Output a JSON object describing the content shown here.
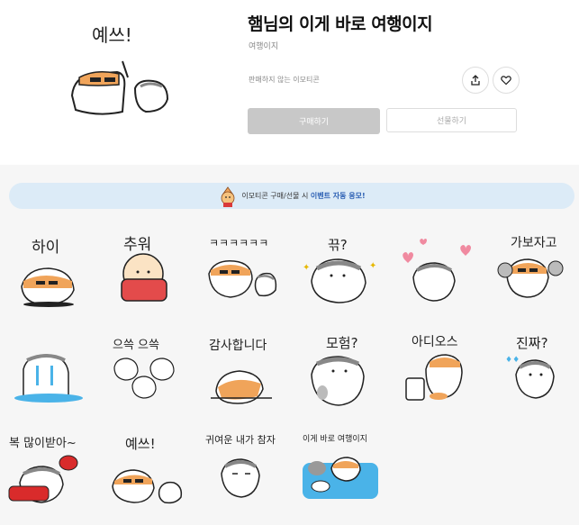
{
  "product": {
    "title": "햄님의 이게 바로 여행이지",
    "author": "여행이지",
    "sale_status": "판매하지 않는 이모티콘",
    "buy_label": "구매하기",
    "gift_label": "선물하기",
    "hero_caption": "예쓰!"
  },
  "actions": {
    "share_icon": "share-icon",
    "like_icon": "heart-icon"
  },
  "banner": {
    "text_before": "이모티콘 구매/선물 시 ",
    "highlight": "이벤트 자동 응모!"
  },
  "stickers": [
    {
      "caption": "하이"
    },
    {
      "caption": "추워"
    },
    {
      "caption": "ㅋㅋㅋㅋㅋㅋ"
    },
    {
      "caption": "끆?"
    },
    {
      "caption": ""
    },
    {
      "caption": "가보자고"
    },
    {
      "caption": ""
    },
    {
      "caption": "으쓱 으쓱"
    },
    {
      "caption": "감사합니다"
    },
    {
      "caption": "모험?"
    },
    {
      "caption": "아디오스"
    },
    {
      "caption": "진짜?"
    },
    {
      "caption": "복 많이받아~"
    },
    {
      "caption": "예쓰!"
    },
    {
      "caption": "귀여운 내가 참자"
    },
    {
      "caption": "이게 바로 여행이지"
    }
  ],
  "colors": {
    "accent_blue": "#2b5fb3",
    "banner_bg": "#dcebf7",
    "hamster_orange": "#f0a45a",
    "button_gray": "#c8c8c8"
  }
}
